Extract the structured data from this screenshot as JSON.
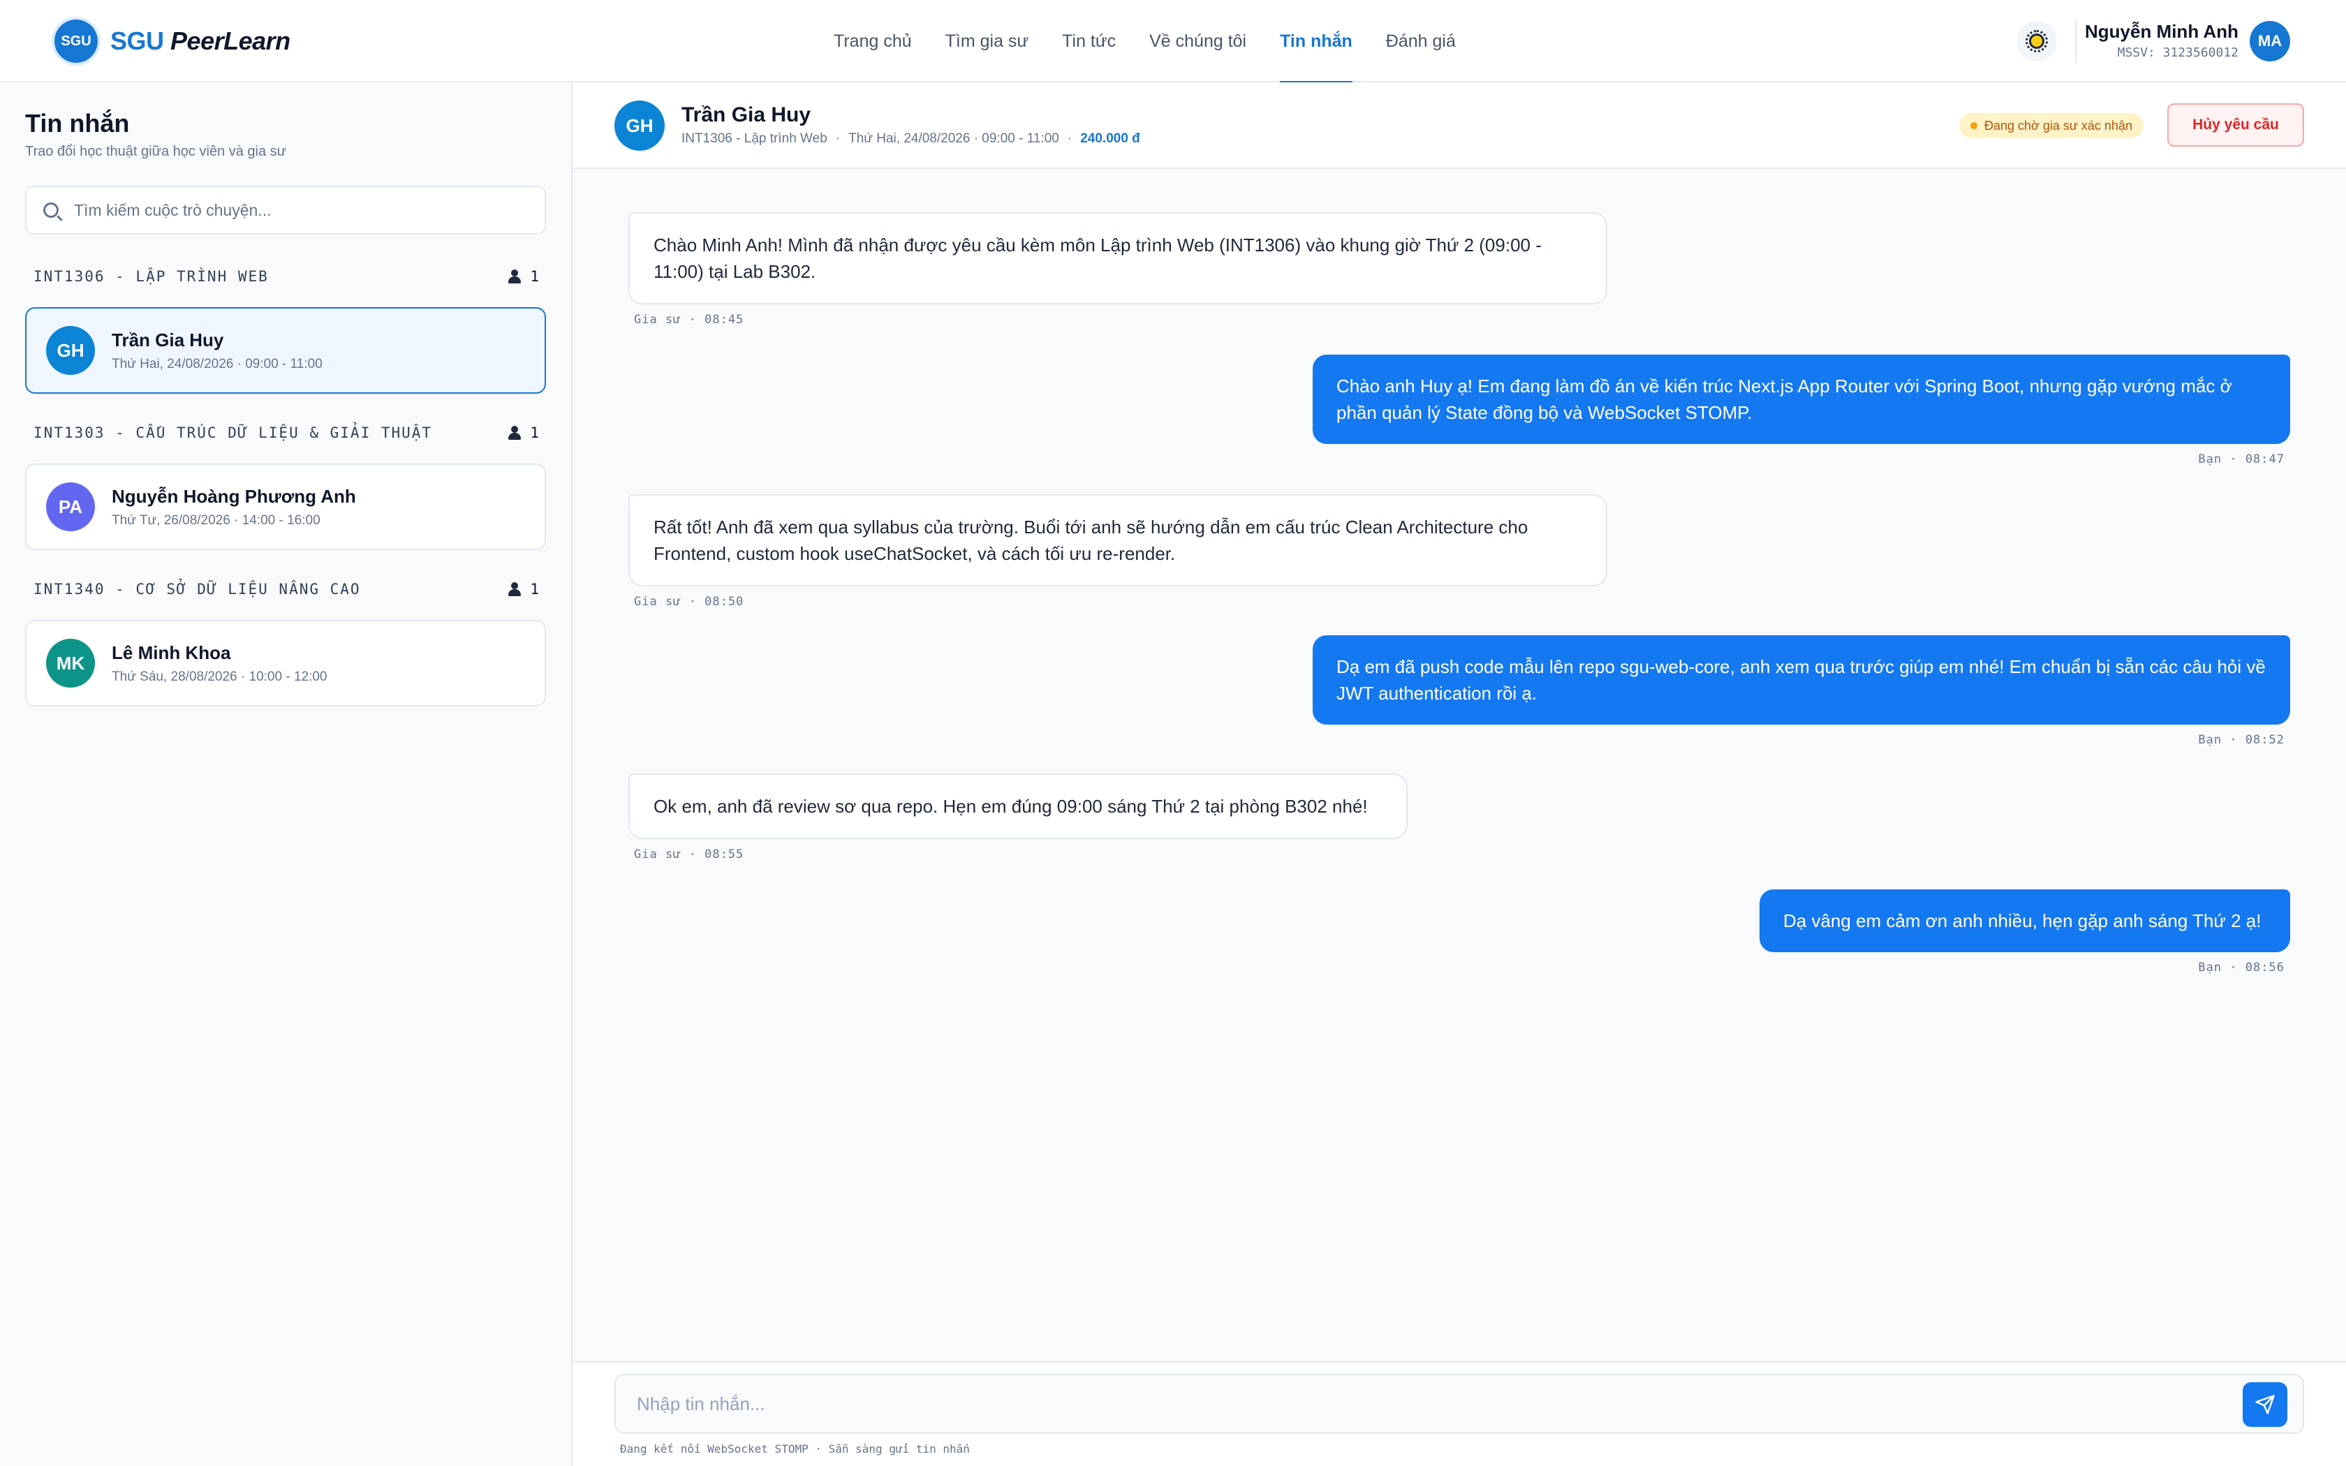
{
  "brand": {
    "logo_text": "SGU",
    "name_part1": "SGU",
    "name_part2": "PeerLearn",
    "accent": "#1677d2"
  },
  "nav": {
    "items": [
      {
        "label": "Trang chủ"
      },
      {
        "label": "Tìm gia sư"
      },
      {
        "label": "Tin tức"
      },
      {
        "label": "Về chúng tôi"
      },
      {
        "label": "Tin nhắn",
        "active": true
      },
      {
        "label": "Đánh giá"
      }
    ]
  },
  "user": {
    "name": "Nguyễn Minh Anh",
    "student_id": "MSSV: 3123560012",
    "initials": "MA"
  },
  "sidebar": {
    "title": "Tin nhắn",
    "subtitle": "Trao đổi học thuật giữa học viên và gia sư",
    "search_placeholder": "Tìm kiếm cuộc trò chuyện...",
    "groups": [
      {
        "label": "INT1306 - LẬP TRÌNH WEB",
        "count": "1",
        "conv": {
          "initials": "GH",
          "name": "Trần Gia Huy",
          "time": "Thứ Hai, 24/08/2026 · 09:00 - 11:00",
          "color": "#0b84d6"
        }
      },
      {
        "label": "INT1303 - CẤU TRÚC DỮ LIỆU & GIẢI THUẬT",
        "count": "1",
        "conv": {
          "initials": "PA",
          "name": "Nguyễn Hoàng Phương Anh",
          "time": "Thứ Tư, 26/08/2026 · 14:00 - 16:00",
          "color": "#6366f1"
        }
      },
      {
        "label": "INT1340 - CƠ SỞ DỮ LIỆU NÂNG CAO",
        "count": "1",
        "conv": {
          "initials": "MK",
          "name": "Lê Minh Khoa",
          "time": "Thứ Sáu, 28/08/2026 · 10:00 - 12:00",
          "color": "#0d9488"
        }
      }
    ]
  },
  "chat": {
    "header": {
      "initials": "GH",
      "name": "Trần Gia Huy",
      "course": "INT1306 - Lập trình Web",
      "schedule": "Thứ Hai, 24/08/2026 · 09:00 - 11:00",
      "price": "240.000 đ",
      "status": "Đang chờ gia sư xác nhận",
      "cancel_label": "Hủy yêu cầu"
    },
    "messages": [
      {
        "side": "in",
        "text": "Chào Minh Anh! Mình đã nhận được yêu cầu kèm môn Lập trình Web (INT1306) vào khung giờ Thứ 2 (09:00 - 11:00) tại Lab B302.",
        "stamp": "Gia sư · 08:45"
      },
      {
        "side": "out",
        "text": "Chào anh Huy ạ! Em đang làm đồ án về kiến trúc Next.js App Router với Spring Boot, nhưng gặp vướng mắc ở phần quản lý State đồng bộ và WebSocket STOMP.",
        "stamp": "Bạn · 08:47"
      },
      {
        "side": "in",
        "text": "Rất tốt! Anh đã xem qua syllabus của trường. Buổi tới anh sẽ hướng dẫn em cấu trúc Clean Architecture cho Frontend, custom hook useChatSocket, và cách tối ưu re-render.",
        "stamp": "Gia sư · 08:50"
      },
      {
        "side": "out",
        "text": "Dạ em đã push code mẫu lên repo sgu-web-core, anh xem qua trước giúp em nhé! Em chuẩn bị sẵn các câu hỏi về JWT authentication rồi ạ.",
        "stamp": "Bạn · 08:52"
      },
      {
        "side": "in",
        "text": "Ok em, anh đã review sơ qua repo. Hẹn em đúng 09:00 sáng Thứ 2 tại phòng B302 nhé!",
        "stamp": "Gia sư · 08:55"
      },
      {
        "side": "out",
        "text": "Dạ vâng em cảm ơn anh nhiều, hẹn gặp anh sáng Thứ 2 ạ!",
        "stamp": "Bạn · 08:56"
      }
    ],
    "composer_placeholder": "Nhập tin nhắn...",
    "ws_status": "Đang kết nối WebSocket STOMP · Sẵn sàng gửi tin nhắn"
  }
}
